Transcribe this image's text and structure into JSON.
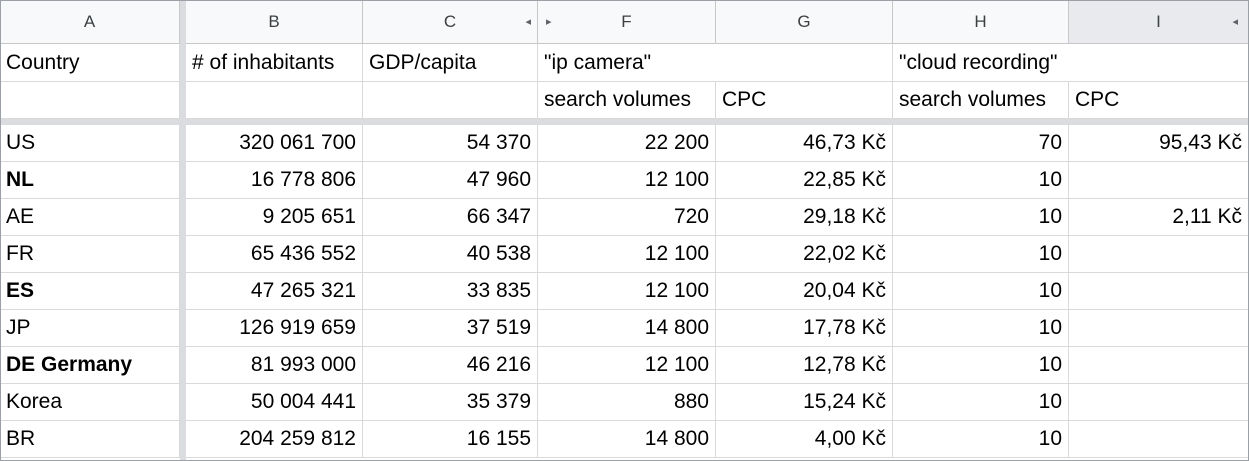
{
  "columns": {
    "A": "A",
    "B": "B",
    "C": "C",
    "F": "F",
    "G": "G",
    "H": "H",
    "I": "I"
  },
  "header": {
    "country": "Country",
    "inhabitants": "# of inhabitants",
    "gdp": "GDP/capita",
    "ip_camera": "\"ip camera\"",
    "cloud_recording": "\"cloud recording\"",
    "ip_search_volumes": "search volumes",
    "ip_cpc": "CPC",
    "cloud_search_volumes": "search volumes",
    "cloud_cpc": "CPC"
  },
  "rows": [
    {
      "country": "US",
      "inhabitants": "320 061 700",
      "gdp": "54 370",
      "ip_sv": "22 200",
      "ip_cpc": "46,73 Kč",
      "cloud_sv": "70",
      "cloud_cpc": "95,43 Kč",
      "bold": false
    },
    {
      "country": "NL",
      "inhabitants": "16 778 806",
      "gdp": "47 960",
      "ip_sv": "12 100",
      "ip_cpc": "22,85 Kč",
      "cloud_sv": "10",
      "cloud_cpc": "",
      "bold": true
    },
    {
      "country": "AE",
      "inhabitants": "9 205 651",
      "gdp": "66 347",
      "ip_sv": "720",
      "ip_cpc": "29,18 Kč",
      "cloud_sv": "10",
      "cloud_cpc": "2,11 Kč",
      "bold": false
    },
    {
      "country": "FR",
      "inhabitants": "65 436 552",
      "gdp": "40 538",
      "ip_sv": "12 100",
      "ip_cpc": "22,02 Kč",
      "cloud_sv": "10",
      "cloud_cpc": "",
      "bold": false
    },
    {
      "country": "ES",
      "inhabitants": "47 265 321",
      "gdp": "33 835",
      "ip_sv": "12 100",
      "ip_cpc": "20,04 Kč",
      "cloud_sv": "10",
      "cloud_cpc": "",
      "bold": true
    },
    {
      "country": "JP",
      "inhabitants": "126 919 659",
      "gdp": "37 519",
      "ip_sv": "14 800",
      "ip_cpc": "17,78 Kč",
      "cloud_sv": "10",
      "cloud_cpc": "",
      "bold": false
    },
    {
      "country": "DE Germany",
      "inhabitants": "81 993 000",
      "gdp": "46 216",
      "ip_sv": "12 100",
      "ip_cpc": "12,78 Kč",
      "cloud_sv": "10",
      "cloud_cpc": "",
      "bold": true
    },
    {
      "country": "Korea",
      "inhabitants": "50 004 441",
      "gdp": "35 379",
      "ip_sv": "880",
      "ip_cpc": "15,24 Kč",
      "cloud_sv": "10",
      "cloud_cpc": "",
      "bold": false
    },
    {
      "country": "BR",
      "inhabitants": "204 259 812",
      "gdp": "16 155",
      "ip_sv": "14 800",
      "ip_cpc": "4,00 Kč",
      "cloud_sv": "10",
      "cloud_cpc": "",
      "bold": false
    }
  ],
  "icons": {
    "left_arrow": "◂",
    "right_arrow": "▸"
  }
}
